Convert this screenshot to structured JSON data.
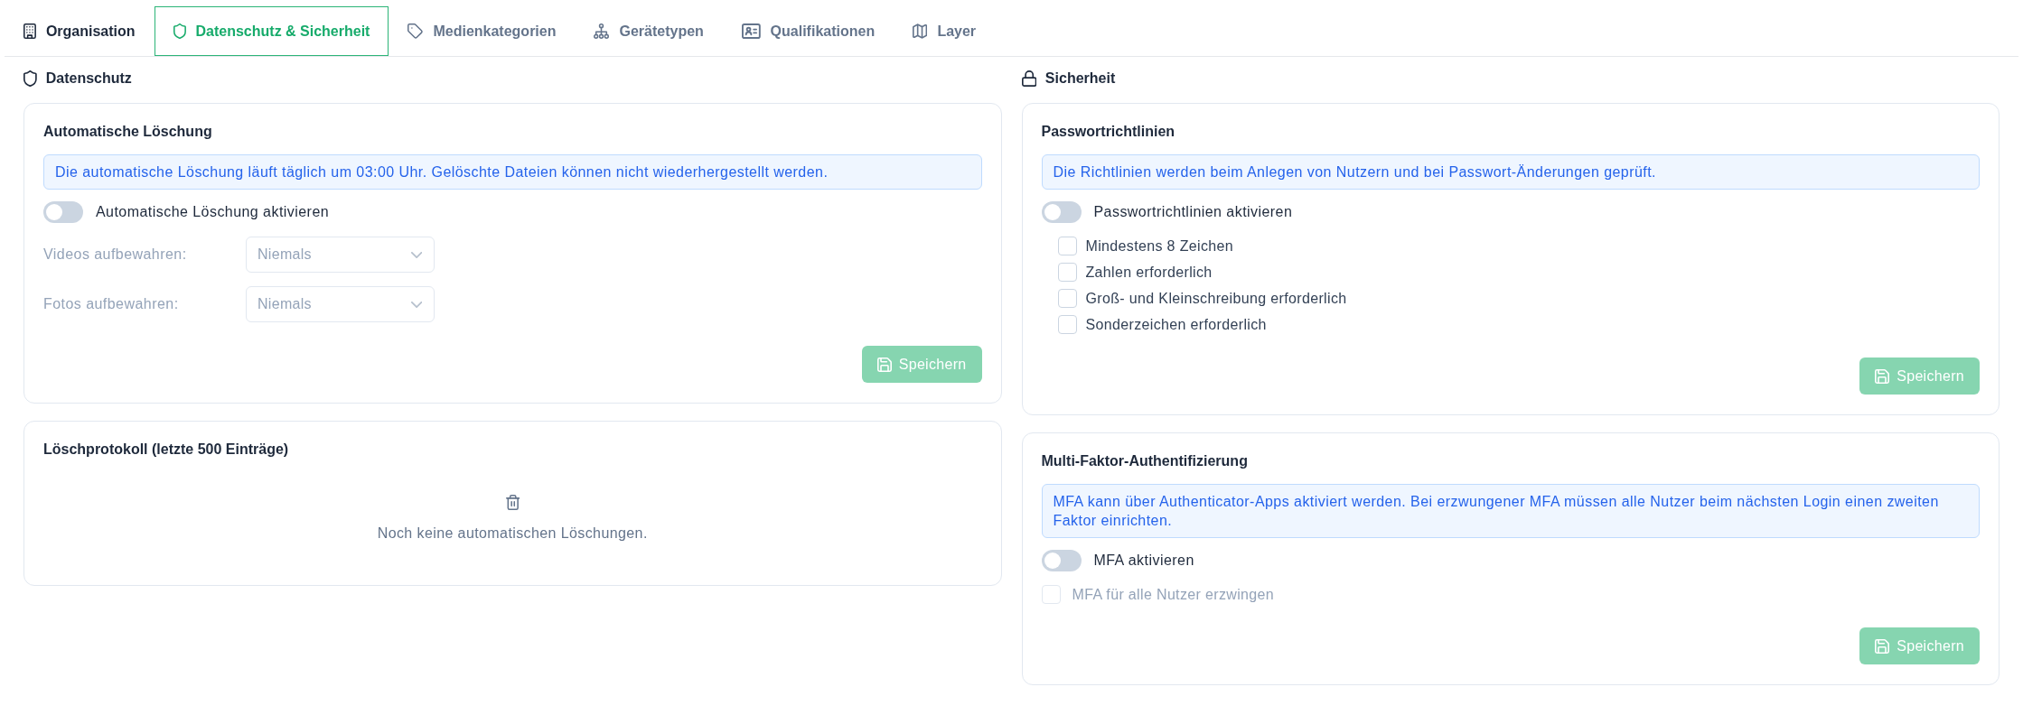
{
  "tabs": [
    {
      "label": "Organisation",
      "selected": false,
      "hovered": true
    },
    {
      "label": "Datenschutz & Sicherheit",
      "selected": true,
      "hovered": false
    },
    {
      "label": "Medienkategorien",
      "selected": false,
      "hovered": false
    },
    {
      "label": "Gerätetypen",
      "selected": false,
      "hovered": false
    },
    {
      "label": "Qualifikationen",
      "selected": false,
      "hovered": false
    },
    {
      "label": "Layer",
      "selected": false,
      "hovered": false
    }
  ],
  "sections": [
    {
      "heading": "Datenschutz",
      "cards": [
        {
          "kind": "settings",
          "title": "Automatische Löschung",
          "info": "Die automatische Löschung läuft täglich um 03:00 Uhr. Gelöschte Dateien können nicht wiederhergestellt werden.",
          "toggle": {
            "label": "Automatische Löschung aktivieren",
            "on": false
          },
          "selects": [
            {
              "label": "Videos aufbewahren:",
              "value": "Niemals",
              "disabled": true
            },
            {
              "label": "Fotos aufbewahren:",
              "value": "Niemals",
              "disabled": true
            }
          ],
          "save": {
            "label": "Speichern",
            "disabled": true
          }
        },
        {
          "kind": "log",
          "title": "Löschprotokoll (letzte 500 Einträge)",
          "empty_text": "Noch keine automatischen Löschungen."
        }
      ]
    },
    {
      "heading": "Sicherheit",
      "cards": [
        {
          "kind": "settings",
          "title": "Passwortrichtlinien",
          "info": "Die Richtlinien werden beim Anlegen von Nutzern und bei Passwort-Änderungen geprüft.",
          "toggle": {
            "label": "Passwortrichtlinien aktivieren",
            "on": false,
            "options": [
              {
                "label": "Mindestens 8 Zeichen",
                "checked": false
              },
              {
                "label": "Zahlen erforderlich",
                "checked": false
              },
              {
                "label": "Groß- und Kleinschreibung erforderlich",
                "checked": false
              },
              {
                "label": "Sonderzeichen erforderlich",
                "checked": false
              }
            ]
          },
          "save": {
            "label": "Speichern",
            "disabled": true
          }
        },
        {
          "kind": "settings",
          "title": "Multi-Faktor-Authentifizierung",
          "info": "MFA kann über Authenticator-Apps aktiviert werden. Bei erzwungener MFA müssen alle Nutzer beim nächsten Login einen zweiten Faktor einrichten.",
          "toggle": {
            "label": "MFA aktivieren",
            "on": false
          },
          "checkboxes": [
            {
              "label": "MFA für alle Nutzer erzwingen",
              "checked": false,
              "disabled": true
            }
          ],
          "save": {
            "label": "Speichern",
            "disabled": true
          }
        }
      ]
    }
  ]
}
